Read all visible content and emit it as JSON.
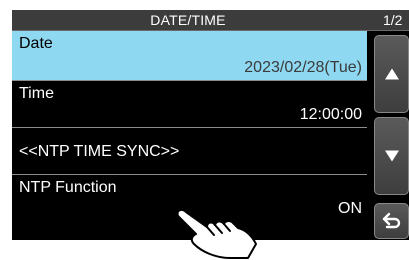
{
  "header": {
    "title": "DATE/TIME",
    "page": "1/2"
  },
  "items": [
    {
      "label": "Date",
      "value": "2023/02/28(Tue)"
    },
    {
      "label": "Time",
      "value": "12:00:00"
    },
    {
      "label": "<<NTP TIME SYNC>>",
      "value": ""
    },
    {
      "label": "NTP Function",
      "value": "ON"
    }
  ],
  "icons": {
    "scroll_up": "up-triangle-icon",
    "scroll_down": "down-triangle-icon",
    "back": "return-arrow-icon",
    "pointer": "tapping-hand-icon"
  },
  "colors": {
    "selected_row": "#8ed8f2",
    "screen_background": "#000000",
    "text": "#ffffff"
  }
}
